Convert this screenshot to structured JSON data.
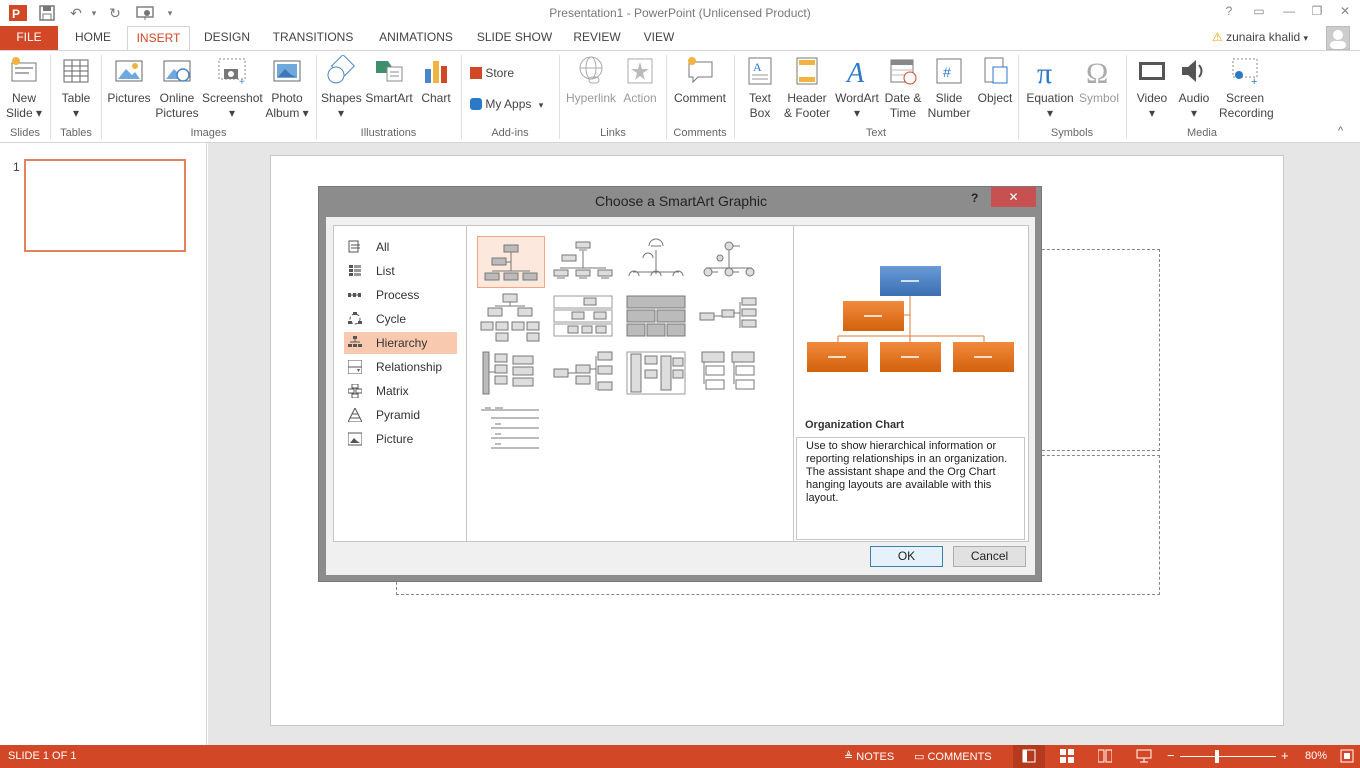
{
  "window": {
    "title": "Presentation1 - PowerPoint (Unlicensed Product)"
  },
  "tabs": [
    "FILE",
    "HOME",
    "INSERT",
    "DESIGN",
    "TRANSITIONS",
    "ANIMATIONS",
    "SLIDE SHOW",
    "REVIEW",
    "VIEW"
  ],
  "active_tab": "INSERT",
  "user": {
    "name": "zunaira khalid"
  },
  "ribbon": {
    "buttons": {
      "new_slide": [
        "New",
        "Slide ▾"
      ],
      "table": [
        "Table",
        "▾"
      ],
      "pictures": [
        "Pictures",
        ""
      ],
      "online_pictures": [
        "Online",
        "Pictures"
      ],
      "screenshot": [
        "Screenshot",
        "▾"
      ],
      "photo_album": [
        "Photo",
        "Album ▾"
      ],
      "shapes": [
        "Shapes",
        "▾"
      ],
      "smartart": [
        "SmartArt",
        ""
      ],
      "chart": [
        "Chart",
        ""
      ],
      "store": "Store",
      "my_apps": "My Apps",
      "hyperlink": [
        "Hyperlink",
        ""
      ],
      "action": [
        "Action",
        ""
      ],
      "comment": [
        "Comment",
        ""
      ],
      "text_box": [
        "Text",
        "Box"
      ],
      "header_footer": [
        "Header",
        "& Footer"
      ],
      "wordart": [
        "WordArt",
        "▾"
      ],
      "date_time": [
        "Date &",
        "Time"
      ],
      "slide_number": [
        "Slide",
        "Number"
      ],
      "object": [
        "Object",
        ""
      ],
      "equation": [
        "Equation",
        "▾"
      ],
      "symbol": [
        "Symbol",
        ""
      ],
      "video": [
        "Video",
        "▾"
      ],
      "audio": [
        "Audio",
        "▾"
      ],
      "screen_recording": [
        "Screen",
        "Recording"
      ]
    },
    "groups": {
      "slides": "Slides",
      "tables": "Tables",
      "images": "Images",
      "illustrations": "Illustrations",
      "addins": "Add-ins",
      "links": "Links",
      "comments": "Comments",
      "text": "Text",
      "symbols": "Symbols",
      "media": "Media"
    }
  },
  "thumbnails": {
    "slide_number": "1"
  },
  "dialog": {
    "title": "Choose a SmartArt Graphic",
    "help": "?",
    "close": "✕",
    "categories": [
      "All",
      "List",
      "Process",
      "Cycle",
      "Hierarchy",
      "Relationship",
      "Matrix",
      "Pyramid",
      "Picture"
    ],
    "selected_category": "Hierarchy",
    "preview_title": "Organization Chart",
    "preview_description": "Use to show hierarchical information or reporting relationships in an organization. The assistant shape and the Org Chart hanging layouts are available with this layout.",
    "ok": "OK",
    "cancel": "Cancel"
  },
  "statusbar": {
    "slide_info": "SLIDE 1 OF 1",
    "notes": "NOTES",
    "comments": "COMMENTS",
    "zoom": "80%"
  },
  "colors": {
    "accent": "#D24726",
    "selection": "#F9C9AF",
    "org_top": "#4F81BD",
    "org_child": "#E46C0A"
  }
}
